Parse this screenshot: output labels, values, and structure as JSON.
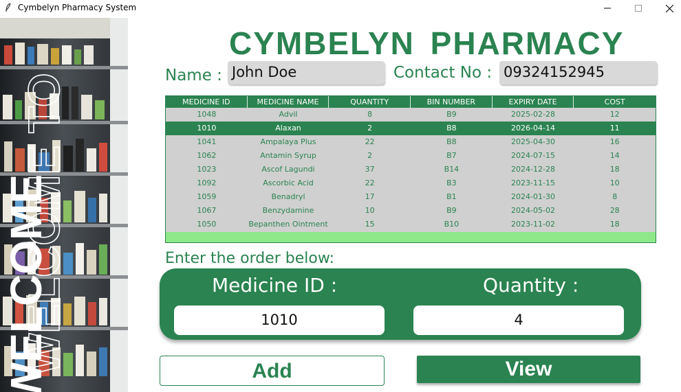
{
  "window": {
    "title": "Cymbelyn Pharmacy System",
    "icon": "feather-icon",
    "controls": [
      "minimize-icon",
      "maximize-icon",
      "close-icon"
    ]
  },
  "banner": {
    "text_solid": "WELCOME",
    "text_outline": "WELCOME TO"
  },
  "header": {
    "brand": "CYMBELYN PHARMACY",
    "name_label": "Name :",
    "name_value": "John Doe",
    "contact_label": "Contact No :",
    "contact_value": "09324152945"
  },
  "table": {
    "columns": [
      "MEDICINE ID",
      "MEDICINE NAME",
      "QUANTITY",
      "BIN NUMBER",
      "EXPIRY DATE",
      "COST"
    ],
    "rows": [
      [
        "1048",
        "Advil",
        "8",
        "B9",
        "2025-02-28",
        "12"
      ],
      [
        "1010",
        "Alaxan",
        "2",
        "B8",
        "2026-04-14",
        "11"
      ],
      [
        "1041",
        "Ampalaya Plus",
        "22",
        "B8",
        "2025-04-30",
        "16"
      ],
      [
        "1062",
        "Antamin Syrup",
        "2",
        "B7",
        "2024-07-15",
        "14"
      ],
      [
        "1023",
        "Ascof Lagundi",
        "37",
        "B14",
        "2024-12-28",
        "18"
      ],
      [
        "1092",
        "Ascorbic Acid",
        "22",
        "B3",
        "2023-11-15",
        "10"
      ],
      [
        "1059",
        "Benadryl",
        "17",
        "B1",
        "2024-01-30",
        "8"
      ],
      [
        "1067",
        "Benzydamine",
        "10",
        "B9",
        "2024-05-02",
        "28"
      ],
      [
        "1050",
        "Bepanthen Ointment",
        "15",
        "B10",
        "2023-11-02",
        "18"
      ]
    ],
    "selected_index": 1
  },
  "order": {
    "prompt": "Enter the order below:",
    "medicine_id_label": "Medicine ID :",
    "medicine_id_value": "1010",
    "quantity_label": "Quantity :",
    "quantity_value": "4"
  },
  "actions": {
    "add_label": "Add",
    "view_label": "View"
  },
  "colors": {
    "accent": "#2a8350",
    "table_bg": "#d0d0d0",
    "table_footer": "#8ee88a"
  }
}
